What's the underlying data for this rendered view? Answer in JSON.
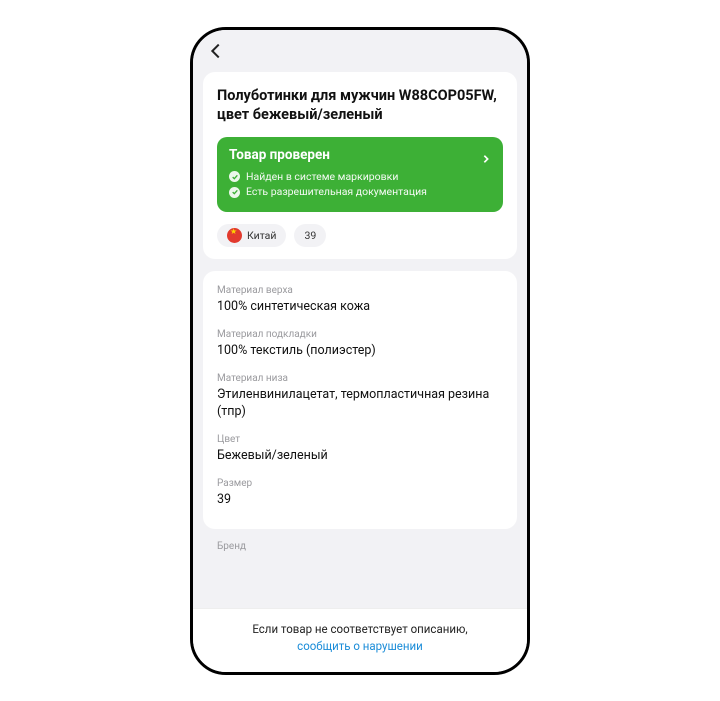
{
  "product": {
    "title": "Полуботинки для мужчин W88COP05FW, цвет бежевый/зеленый"
  },
  "verify": {
    "title": "Товар проверен",
    "line1": "Найден в системе маркировки",
    "line2": "Есть разрешительная документация"
  },
  "chips": {
    "country": "Китай",
    "size": "39"
  },
  "specs": {
    "upper_label": "Материал верха",
    "upper_value": "100% синтетическая кожа",
    "lining_label": "Материал подкладки",
    "lining_value": "100% текстиль (полиэстер)",
    "sole_label": "Материал низа",
    "sole_value": "Этиленвинилацетат, термопластичная резина (тпр)",
    "color_label": "Цвет",
    "color_value": "Бежевый/зеленый",
    "size_label": "Размер",
    "size_value": "39",
    "brand_label": "Бренд"
  },
  "footer": {
    "line1": "Если товар не соответствует описанию,",
    "link": "сообщить о нарушении"
  }
}
